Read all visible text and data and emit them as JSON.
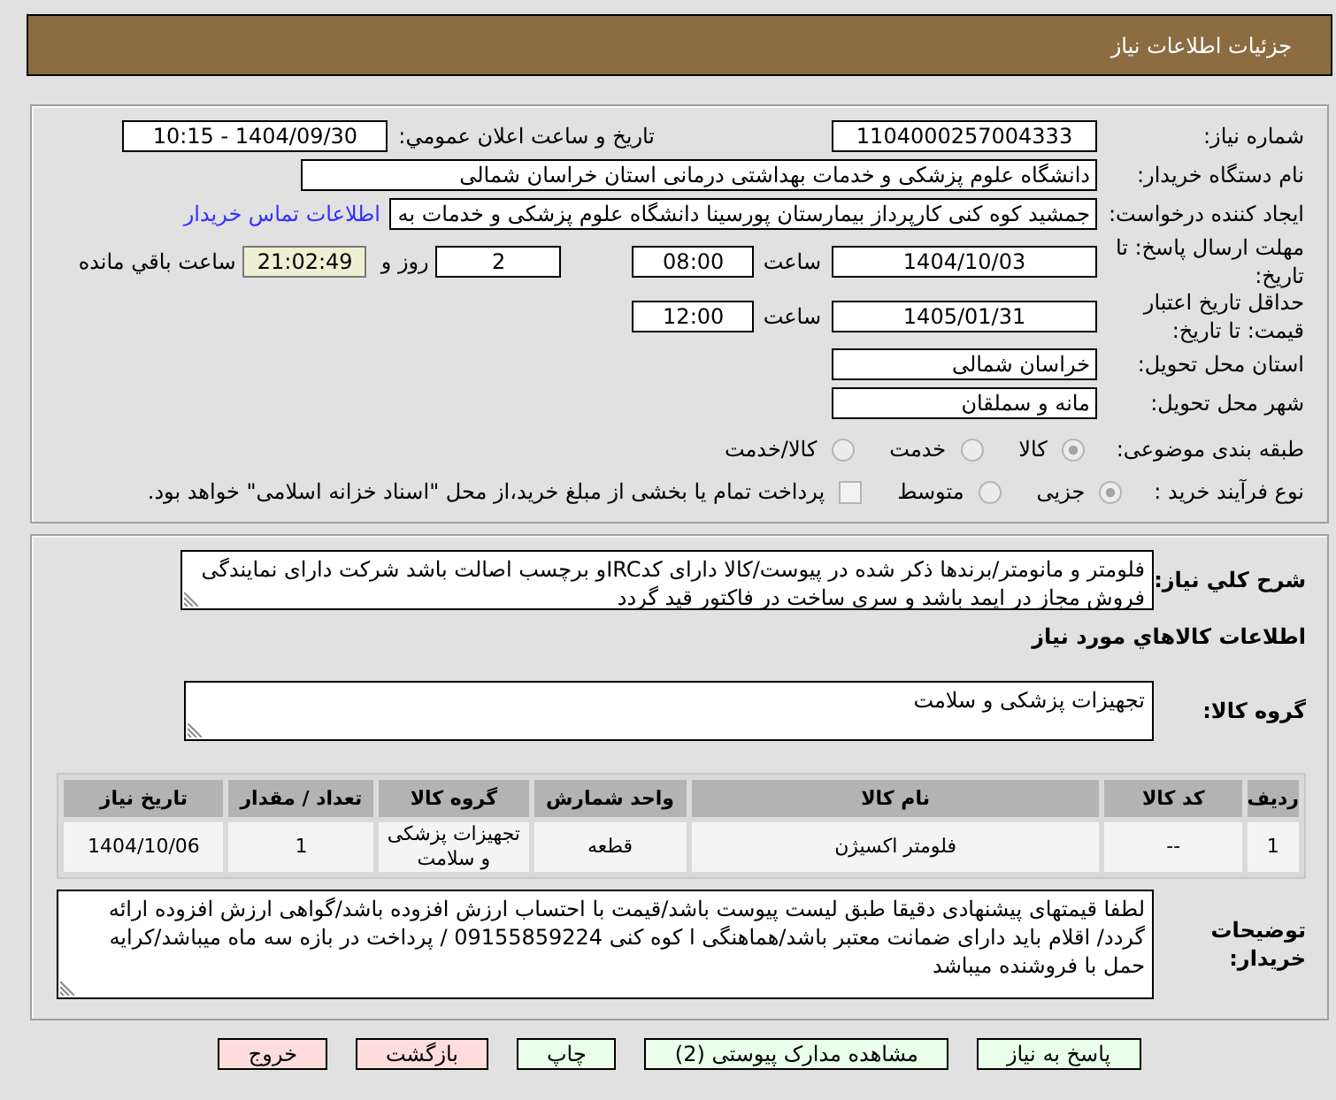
{
  "header": {
    "title": "جزئیات اطلاعات نیاز"
  },
  "need_number": {
    "label": "شماره نیاز:",
    "value": "1104000257004333"
  },
  "announcement": {
    "label": "تاريخ و ساعت اعلان عمومي:",
    "value": "1404/09/30 - 10:15"
  },
  "buyer_org": {
    "label": "نام دستگاه خریدار:",
    "value": "دانشگاه علوم پزشکی و خدمات بهداشتی درمانی استان خراسان شمالی"
  },
  "requester": {
    "label": "ایجاد کننده درخواست:",
    "value": "جمشید کوه کنی کارپرداز بیمارستان پورسینا دانشگاه علوم پزشکی و خدمات به",
    "contact_link": "اطلاعات تماس خریدار"
  },
  "reply_deadline": {
    "label": "مهلت ارسال پاسخ: تا تاریخ:",
    "date": "1404/10/03",
    "time_label": "ساعت",
    "time": "08:00",
    "days": "2",
    "days_label": "روز و",
    "remaining": "21:02:49",
    "remaining_label": "ساعت باقي مانده"
  },
  "price_validity": {
    "label": "حداقل تاریخ اعتبار قیمت: تا تاریخ:",
    "date": "1405/01/31",
    "time_label": "ساعت",
    "time": "12:00"
  },
  "delivery_province": {
    "label": "استان محل تحویل:",
    "value": "خراسان شمالی"
  },
  "delivery_city": {
    "label": "شهر محل تحویل:",
    "value": "مانه و سملقان"
  },
  "subject_category": {
    "label": "طبقه بندی موضوعی:",
    "options": [
      {
        "label": "کالا",
        "selected": true,
        "disabled": true
      },
      {
        "label": "خدمت",
        "selected": false,
        "disabled": true
      },
      {
        "label": "کالا/خدمت",
        "selected": false,
        "disabled": true
      }
    ]
  },
  "purchase_process": {
    "label": "نوع فرآیند خرید :",
    "options": [
      {
        "label": "جزیی",
        "selected": true,
        "disabled": true
      },
      {
        "label": "متوسط",
        "selected": false,
        "disabled": true
      }
    ],
    "treasury_option": {
      "label": "پرداخت تمام یا بخشی از مبلغ خرید،از محل \"اسناد خزانه اسلامی\" خواهد بود.",
      "checked": false
    }
  },
  "need_description": {
    "label": "شرح کلي نیاز:",
    "value": "فلومتر و مانومتر/برندها ذکر شده در پیوست/کالا دارای کدIRCو برچسب اصالت باشد شرکت دارای نمایندگی فروش مجاز در ایمد باشد و سری ساخت در فاکتور قید گردد"
  },
  "goods_section": {
    "title": "اطلاعات كالاهاي مورد نیاز",
    "goods_group": {
      "label": "گروه کالا:",
      "value": "تجهیزات پزشکی و سلامت"
    },
    "table": {
      "columns": [
        "ردیف",
        "کد کالا",
        "نام کالا",
        "واحد شمارش",
        "گروه کالا",
        "تعداد / مقدار",
        "تاریخ نیاز"
      ],
      "rows": [
        {
          "cells": [
            "1",
            "--",
            "فلومتر اکسیژن",
            "قطعه",
            "تجهیزات پزشکی و سلامت",
            "1",
            "1404/10/06"
          ]
        }
      ]
    }
  },
  "buyer_notes": {
    "label": "توضیحات خریدار:",
    "value": "لطفا قیمتهای پیشنهادی دقیقا طبق لیست پیوست باشد/قیمت با احتساب ارزش افزوده باشد/گواهی ارزش افزوده ارائه گردد/ اقلام باید دارای ضمانت معتبر باشد/هماهنگی ا کوه کنی 09155859224 / پرداخت در بازه سه ماه میباشد/کرایه حمل با فروشنده میباشد"
  },
  "buttons": [
    {
      "label": "پاسخ به نیاز",
      "kind": "action"
    },
    {
      "label": "مشاهده مدارک پیوستی (2)",
      "kind": "action"
    },
    {
      "label": "چاپ",
      "kind": "action"
    },
    {
      "label": "بازگشت",
      "kind": "exit"
    },
    {
      "label": "خروج",
      "kind": "exit"
    }
  ]
}
